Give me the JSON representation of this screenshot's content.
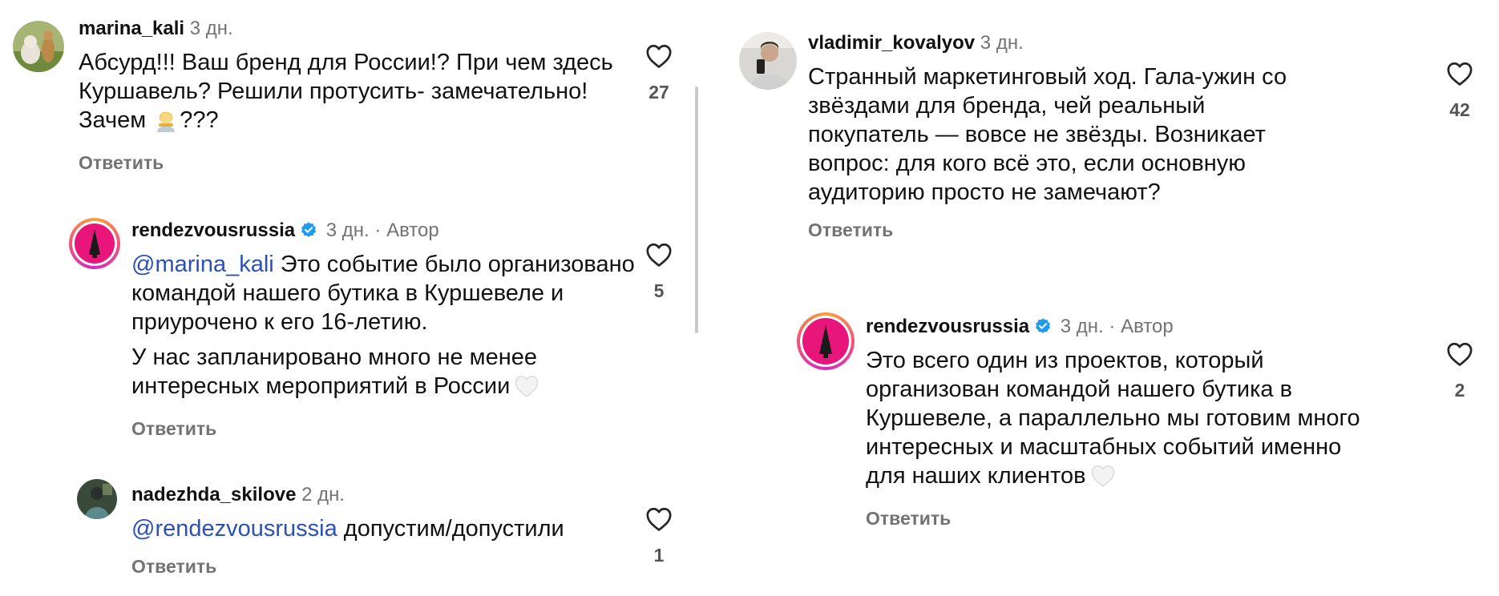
{
  "left": {
    "comments": [
      {
        "username": "marina_kali",
        "time": "3 дн.",
        "text": "Абсурд!!! Ваш бренд для России!? При чем здесь Куршавель? Решили протусить- замечательно! Зачем",
        "text_tail": "???",
        "reply_label": "Ответить",
        "likes": "27",
        "avatar_icon": "dogs-photo-avatar"
      },
      {
        "username": "rendezvousrussia",
        "time": "3 дн.",
        "separator": "·",
        "author_tag": "Автор",
        "mention": "@marina_kali",
        "text1": " Это событие было организовано командой нашего бутика в Куршевеле и приурочено к его 16-летию.",
        "text2": "У нас запланировано много не менее интересных мероприятий в России",
        "reply_label": "Ответить",
        "likes": "5",
        "avatar_icon": "brand-logo-avatar"
      },
      {
        "username": "nadezhda_skilove",
        "time": "2 дн.",
        "mention": "@rendezvousrussia",
        "text": " допустим/допустили",
        "reply_label": "Ответить",
        "likes": "1",
        "avatar_icon": "person-photo-avatar"
      }
    ]
  },
  "right": {
    "comments": [
      {
        "username": "vladimir_kovalyov",
        "time": "3 дн.",
        "text": "Странный маркетинговый ход. Гала-ужин со звёздами для бренда, чей реальный покупатель — вовсе не звёзды. Возникает вопрос: для кого всё это, если основную аудиторию просто не замечают?",
        "reply_label": "Ответить",
        "likes": "42",
        "avatar_icon": "man-photo-avatar"
      },
      {
        "username": "rendezvousrussia",
        "time": "3 дн.",
        "separator": "·",
        "author_tag": "Автор",
        "text": "Это всего один из проектов, который организован командой нашего бутика в Куршевеле, а параллельно мы готовим много интересных и масштабных событий именно для наших клиентов",
        "reply_label": "Ответить",
        "likes": "2",
        "avatar_icon": "brand-logo-avatar"
      }
    ]
  },
  "colors": {
    "username": "#111111",
    "meta": "#737373",
    "mention": "#2b51b7",
    "verified": "#1d9bf0",
    "brand_pink": "#e8157a"
  }
}
